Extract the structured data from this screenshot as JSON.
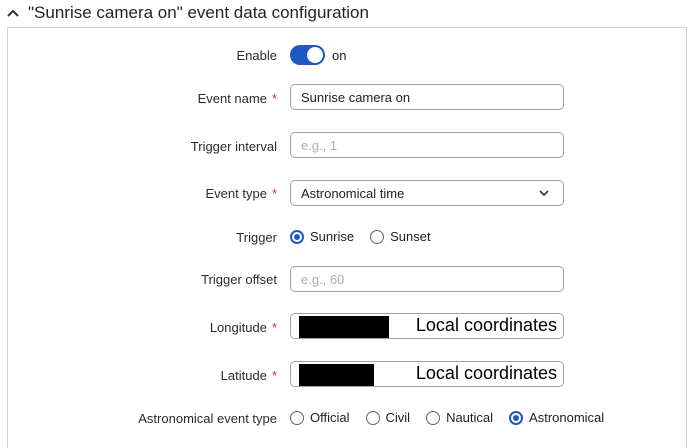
{
  "section": {
    "title": "\"Sunrise camera on\" event data configuration"
  },
  "enable": {
    "label": "Enable",
    "state": "on"
  },
  "event_name": {
    "label": "Event name",
    "required": "*",
    "value": "Sunrise camera on"
  },
  "trigger_interval": {
    "label": "Trigger interval",
    "placeholder": "e.g., 1"
  },
  "event_type": {
    "label": "Event type",
    "required": "*",
    "value": "Astronomical time"
  },
  "trigger": {
    "label": "Trigger",
    "options": [
      "Sunrise",
      "Sunset"
    ],
    "selected": "Sunrise"
  },
  "trigger_offset": {
    "label": "Trigger offset",
    "placeholder": "e.g., 60"
  },
  "longitude": {
    "label": "Longitude",
    "required": "*",
    "overlay_text": "Local coordinates"
  },
  "latitude": {
    "label": "Latitude",
    "required": "*",
    "overlay_text": "Local coordinates"
  },
  "astro_event_type": {
    "label": "Astronomical event type",
    "options": [
      "Official",
      "Civil",
      "Nautical",
      "Astronomical"
    ],
    "selected": "Astronomical"
  },
  "colors": {
    "accent": "#1f57c3",
    "required": "#d32f2f",
    "border": "#9aa3ad"
  }
}
